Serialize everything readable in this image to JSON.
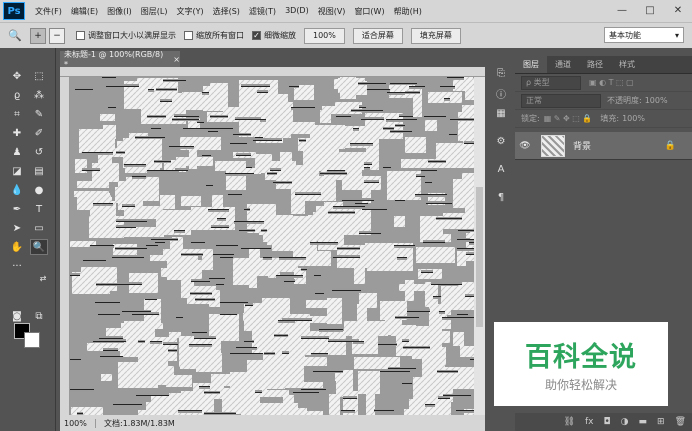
{
  "app": {
    "logo": "Ps"
  },
  "menu": [
    "文件(F)",
    "编辑(E)",
    "图像(I)",
    "图层(L)",
    "文字(Y)",
    "选择(S)",
    "滤镜(T)",
    "3D(D)",
    "视图(V)",
    "窗口(W)",
    "帮助(H)"
  ],
  "window_controls": {
    "minimize": "—",
    "maximize": "□",
    "close": "✕"
  },
  "options": {
    "resize_windows": "调整窗口大小以满屏显示",
    "zoom_all": "缩放所有窗口",
    "scrubby": "细微缩放",
    "zoom_value": "100%",
    "fit_screen": "适合屏幕",
    "fill_screen": "填充屏幕",
    "workspace": "基本功能"
  },
  "document": {
    "tab": "未标题-1 @ 100%(RGB/8) *",
    "close": "×"
  },
  "status": {
    "zoom": "100%",
    "info": "文档:1.83M/1.83M"
  },
  "panel": {
    "tabs": [
      "图层",
      "通道",
      "路径",
      "样式"
    ],
    "filter_kind": "ρ 类型",
    "blend_mode": "正常",
    "opacity_label": "不透明度:",
    "opacity_value": "100%",
    "lock_label": "锁定:",
    "fill_label": "填充:",
    "fill_value": "100%",
    "layer_name": "背景"
  },
  "watermark": {
    "title": "百科全说",
    "subtitle": "助你轻松解决"
  },
  "colors": {
    "accent": "#31a8ff",
    "watermark_green": "#2ea55d"
  }
}
